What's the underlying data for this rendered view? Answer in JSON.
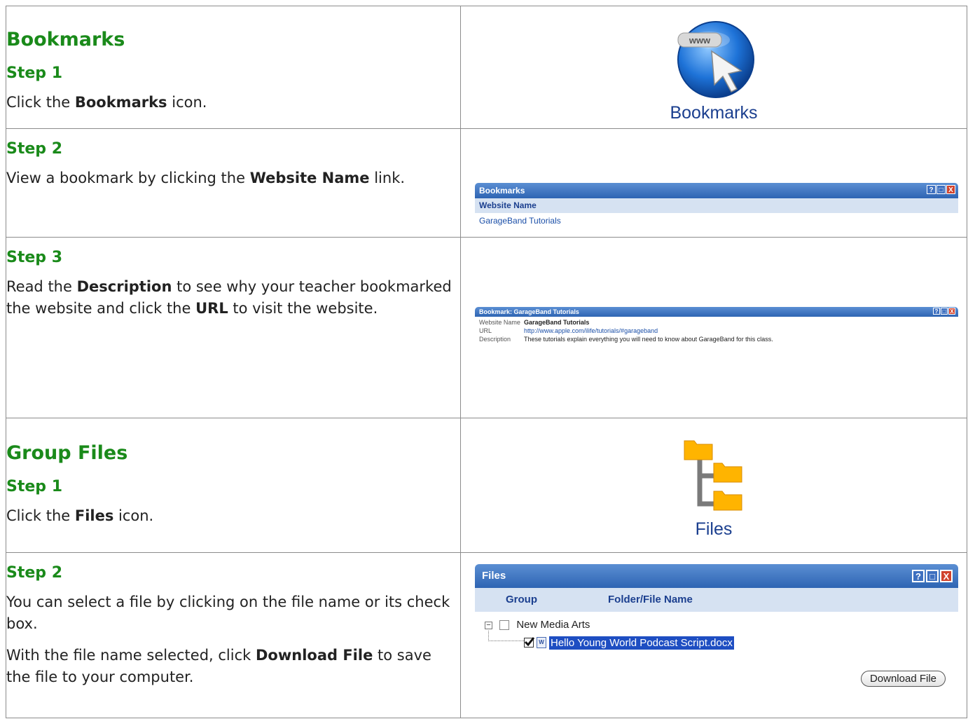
{
  "bookmarks": {
    "section_title": "Bookmarks",
    "step1": {
      "label": "Step 1",
      "text_before": "Click the ",
      "bold": "Bookmarks",
      "text_after": " icon.",
      "icon_caption": "Bookmarks",
      "globe_badge": "www"
    },
    "step2": {
      "label": "Step 2",
      "text_before": "View a bookmark by clicking the ",
      "bold": "Website Name",
      "text_after": " link.",
      "window": {
        "title": "Bookmarks",
        "column_header": "Website Name",
        "link": "GarageBand Tutorials"
      }
    },
    "step3": {
      "label": "Step 3",
      "text_1": "Read the ",
      "bold_1": "Description",
      "text_2": " to see why your teacher bookmarked the website and click the ",
      "bold_2": "URL",
      "text_3": " to visit the website.",
      "window": {
        "title": "Bookmark: GarageBand Tutorials",
        "rows": [
          {
            "label": "Website Name",
            "value": "GarageBand Tutorials"
          },
          {
            "label": "URL",
            "value": "http://www.apple.com/ilife/tutorials/#garageband"
          },
          {
            "label": "Description",
            "value": "These tutorials explain everything you will need to know about GarageBand for this class."
          }
        ]
      }
    }
  },
  "group_files": {
    "section_title": "Group Files",
    "step1": {
      "label": "Step 1",
      "text_before": "Click the ",
      "bold": "Files",
      "text_after": " icon.",
      "icon_caption": "Files"
    },
    "step2": {
      "label": "Step 2",
      "para1": "You can select a file by clicking on the file name or its check box.",
      "para2_before": "With the file name selected, click ",
      "para2_bold": "Download File",
      "para2_after": " to save the file to your computer.",
      "window": {
        "title": "Files",
        "col_group": "Group",
        "col_name": "Folder/File Name",
        "folder": "New Media Arts",
        "file": "Hello Young World Podcast Script.docx",
        "download_button": "Download File"
      }
    }
  },
  "window_buttons": {
    "help": "?",
    "max": "□",
    "close": "X"
  },
  "colors": {
    "heading_green": "#1a8a1a",
    "title_bar_blue": "#2e64b3",
    "header_row": "#d6e2f2",
    "close_red": "#d0422c"
  }
}
